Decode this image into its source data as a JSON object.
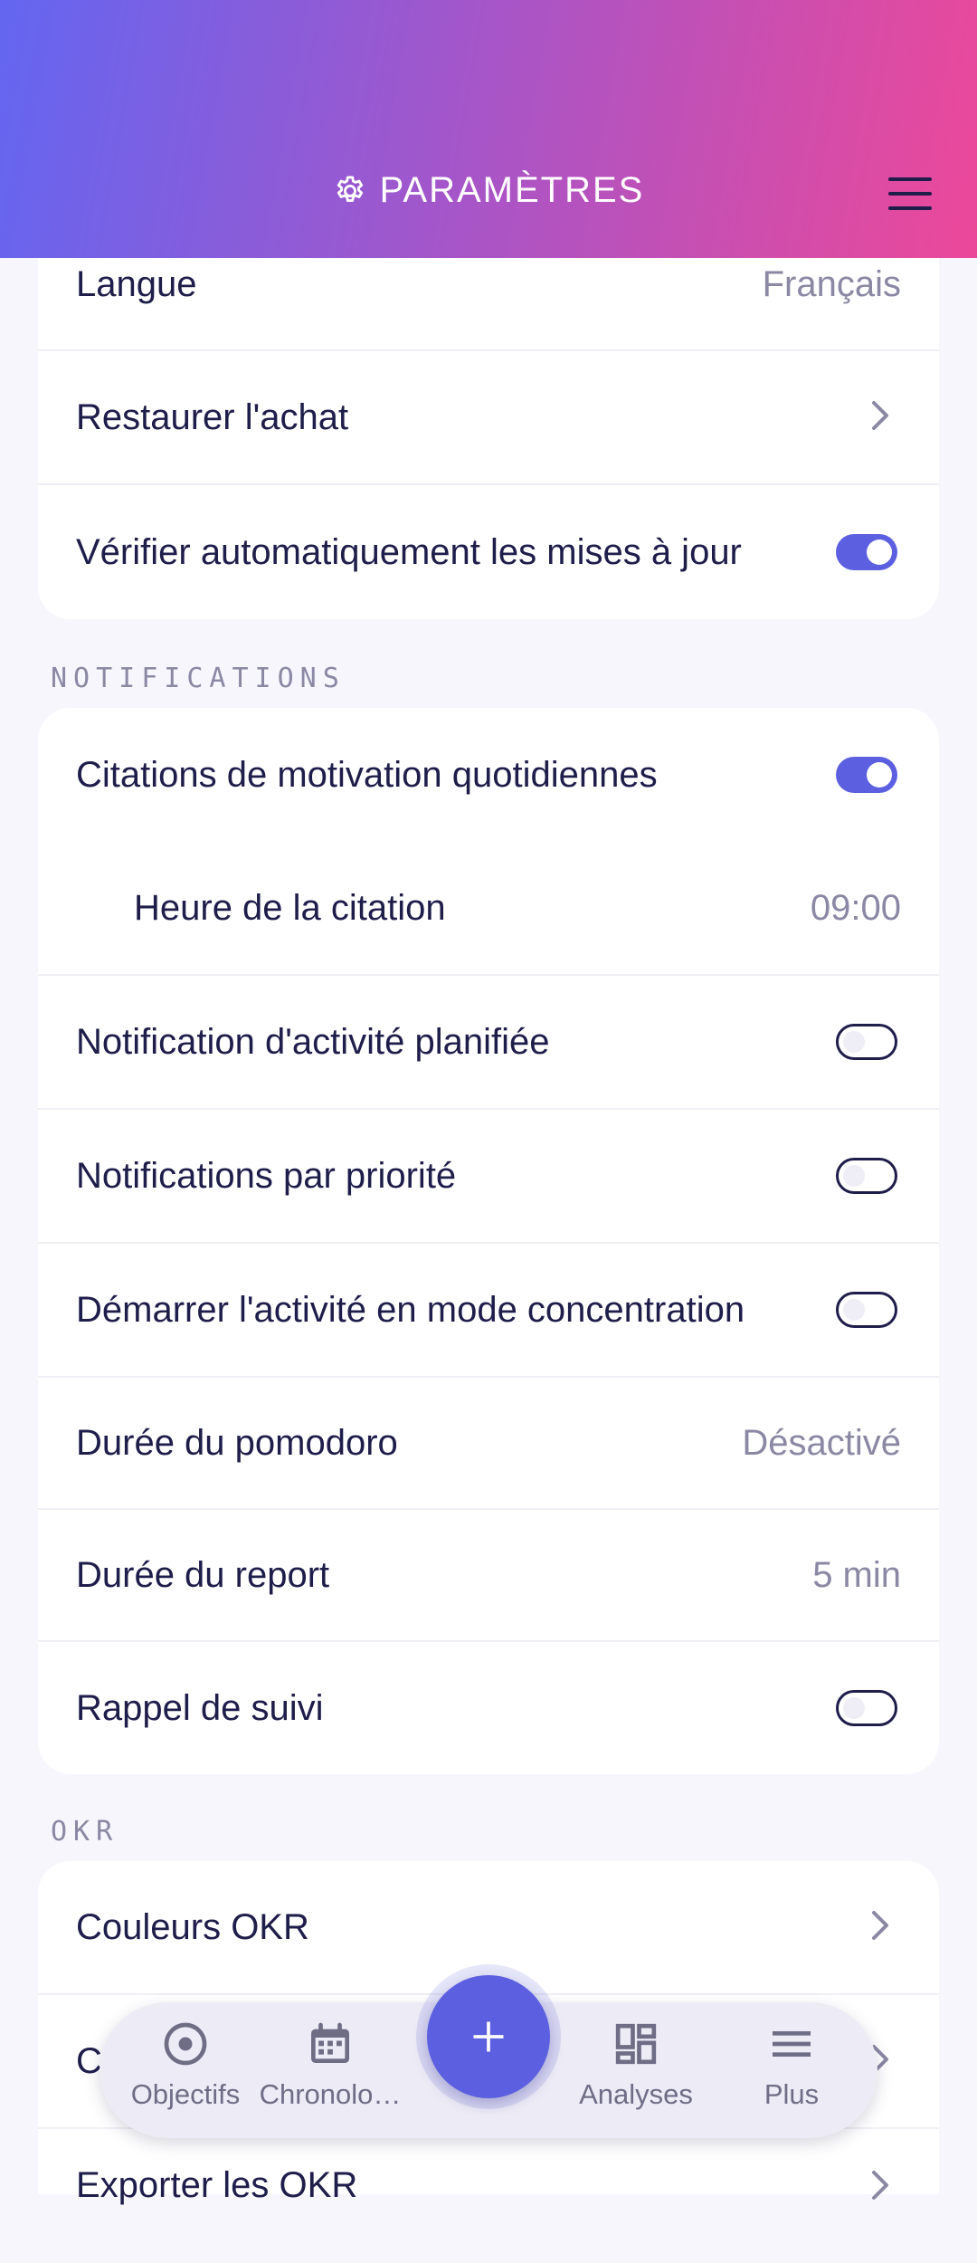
{
  "header": {
    "title": "PARAMÈTRES"
  },
  "general": {
    "language": {
      "label": "Langue",
      "value": "Français"
    },
    "restore": {
      "label": "Restaurer l'achat"
    },
    "auto_update": {
      "label": "Vérifier automatiquement les mises à jour",
      "enabled": true
    }
  },
  "notifications": {
    "section_title": "NOTIFICATIONS",
    "daily_quotes": {
      "label": "Citations de motivation quotidiennes",
      "enabled": true
    },
    "quote_time": {
      "label": "Heure de la citation",
      "value": "09:00"
    },
    "scheduled_activity": {
      "label": "Notification d'activité planifiée",
      "enabled": false
    },
    "priority": {
      "label": "Notifications par priorité",
      "enabled": false
    },
    "focus_mode": {
      "label": "Démarrer l'activité en mode concentration",
      "enabled": false
    },
    "pomodoro": {
      "label": "Durée du pomodoro",
      "value": "Désactivé"
    },
    "snooze": {
      "label": "Durée du report",
      "value": "5 min"
    },
    "followup": {
      "label": "Rappel de suivi",
      "enabled": false
    }
  },
  "okr": {
    "section_title": "OKR",
    "colors": {
      "label": "Couleurs OKR"
    },
    "partial_row": {
      "label": "C"
    },
    "export": {
      "label": "Exporter les OKR"
    }
  },
  "nav": {
    "items": [
      {
        "label": "Objectifs",
        "icon": "target-icon"
      },
      {
        "label": "Chronolo…",
        "icon": "calendar-icon"
      },
      {
        "label": "Analyses",
        "icon": "dashboard-icon"
      },
      {
        "label": "Plus",
        "icon": "menu-icon"
      }
    ],
    "fab": {
      "icon": "plus-icon"
    }
  },
  "colors": {
    "accent": "#5b5fe0",
    "text": "#1f1d4a",
    "muted": "#8a88a3"
  }
}
